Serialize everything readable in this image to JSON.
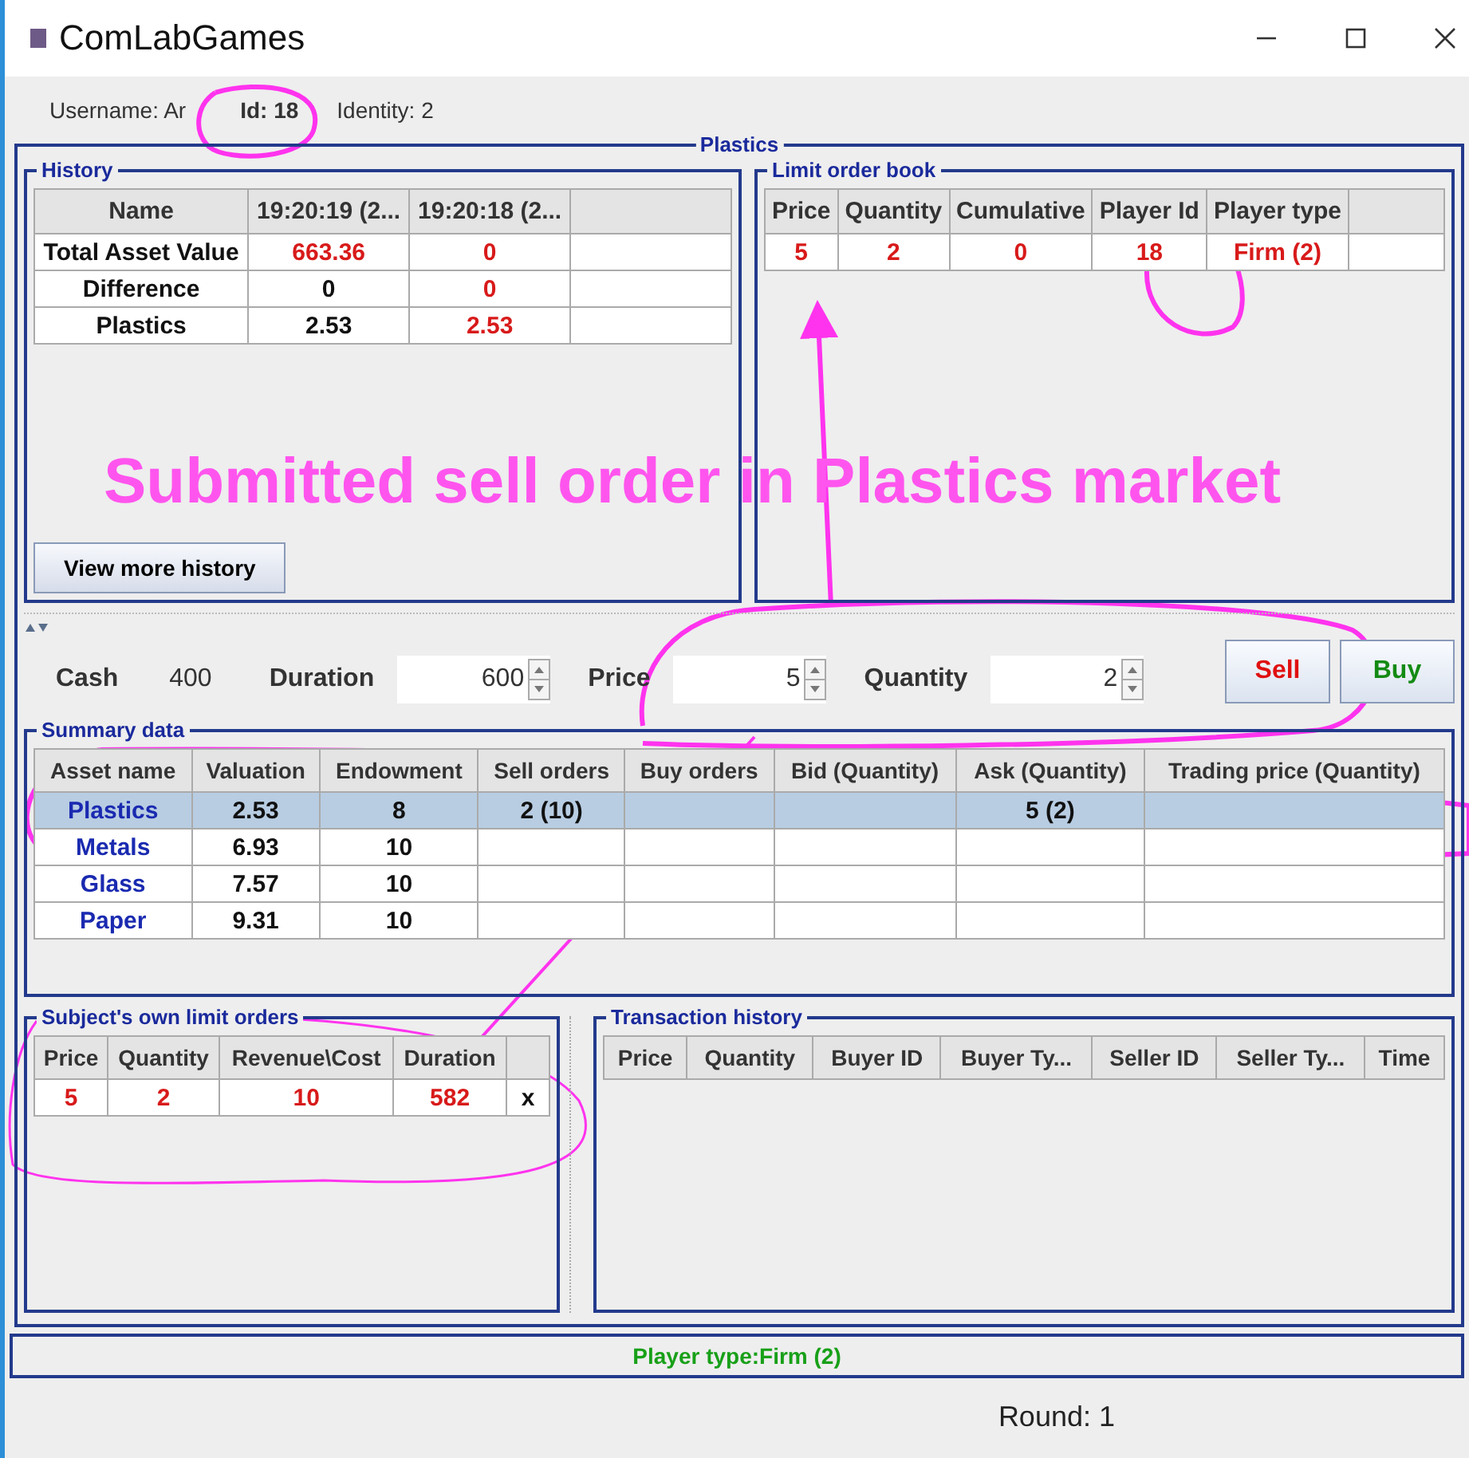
{
  "window": {
    "title": "ComLabGames"
  },
  "info": {
    "username": "Username: Ar",
    "id": "Id: 18",
    "identity": "Identity: 2"
  },
  "market_panel": {
    "title": "Plastics"
  },
  "history": {
    "title": "History",
    "columns": [
      "Name",
      "19:20:19 (2...",
      "19:20:18 (2..."
    ],
    "rows": [
      {
        "cells": [
          {
            "text": "Total Asset Value",
            "changed": false
          },
          {
            "text": "663.36",
            "changed": true
          },
          {
            "text": "0",
            "changed": true
          }
        ]
      },
      {
        "cells": [
          {
            "text": "Difference",
            "changed": false
          },
          {
            "text": "0",
            "changed": false
          },
          {
            "text": "0",
            "changed": true
          }
        ]
      },
      {
        "cells": [
          {
            "text": "Plastics",
            "changed": false
          },
          {
            "text": "2.53",
            "changed": false
          },
          {
            "text": "2.53",
            "changed": true
          }
        ]
      }
    ],
    "button": "View more history"
  },
  "limit_order_book": {
    "title": "Limit order book",
    "columns": [
      "Price",
      "Quantity",
      "Cumulative",
      "Player Id",
      "Player type"
    ],
    "rows": [
      [
        "5",
        "2",
        "0",
        "18",
        "Firm (2)"
      ]
    ]
  },
  "controls": {
    "cash_label": "Cash",
    "cash": "400",
    "fields": [
      {
        "label": "Duration",
        "value": "600"
      },
      {
        "label": "Price",
        "value": "5"
      },
      {
        "label": "Quantity",
        "value": "2"
      }
    ],
    "buttons": [
      {
        "label": "Sell",
        "kind": "sell"
      },
      {
        "label": "Buy",
        "kind": "buy"
      }
    ]
  },
  "summary": {
    "title": "Summary data",
    "columns": [
      "Asset name",
      "Valuation",
      "Endowment",
      "Sell orders",
      "Buy orders",
      "Bid (Quantity)",
      "Ask (Quantity)",
      "Trading price (Quantity)"
    ],
    "rows": [
      {
        "selected": true,
        "cells": [
          "Plastics",
          "2.53",
          "8",
          "2 (10)",
          "",
          "",
          "5 (2)",
          ""
        ]
      },
      {
        "selected": false,
        "cells": [
          "Metals",
          "6.93",
          "10",
          "",
          "",
          "",
          "",
          ""
        ]
      },
      {
        "selected": false,
        "cells": [
          "Glass",
          "7.57",
          "10",
          "",
          "",
          "",
          "",
          ""
        ]
      },
      {
        "selected": false,
        "cells": [
          "Paper",
          "9.31",
          "10",
          "",
          "",
          "",
          "",
          ""
        ]
      }
    ]
  },
  "own_orders": {
    "title": "Subject's own limit orders",
    "columns": [
      "Price",
      "Quantity",
      "Revenue\\Cost",
      "Duration"
    ],
    "rows": [
      {
        "cells": [
          "5",
          "2",
          "10",
          "582"
        ],
        "cancel": "x"
      }
    ]
  },
  "transactions": {
    "title": "Transaction history",
    "columns": [
      "Price",
      "Quantity",
      "Buyer ID",
      "Buyer Ty...",
      "Seller ID",
      "Seller Ty...",
      "Time"
    ]
  },
  "status": {
    "player_type": "Player type:Firm (2)",
    "round": "Round: 1"
  },
  "annotation": {
    "text": "Submitted sell order in Plastics market"
  }
}
